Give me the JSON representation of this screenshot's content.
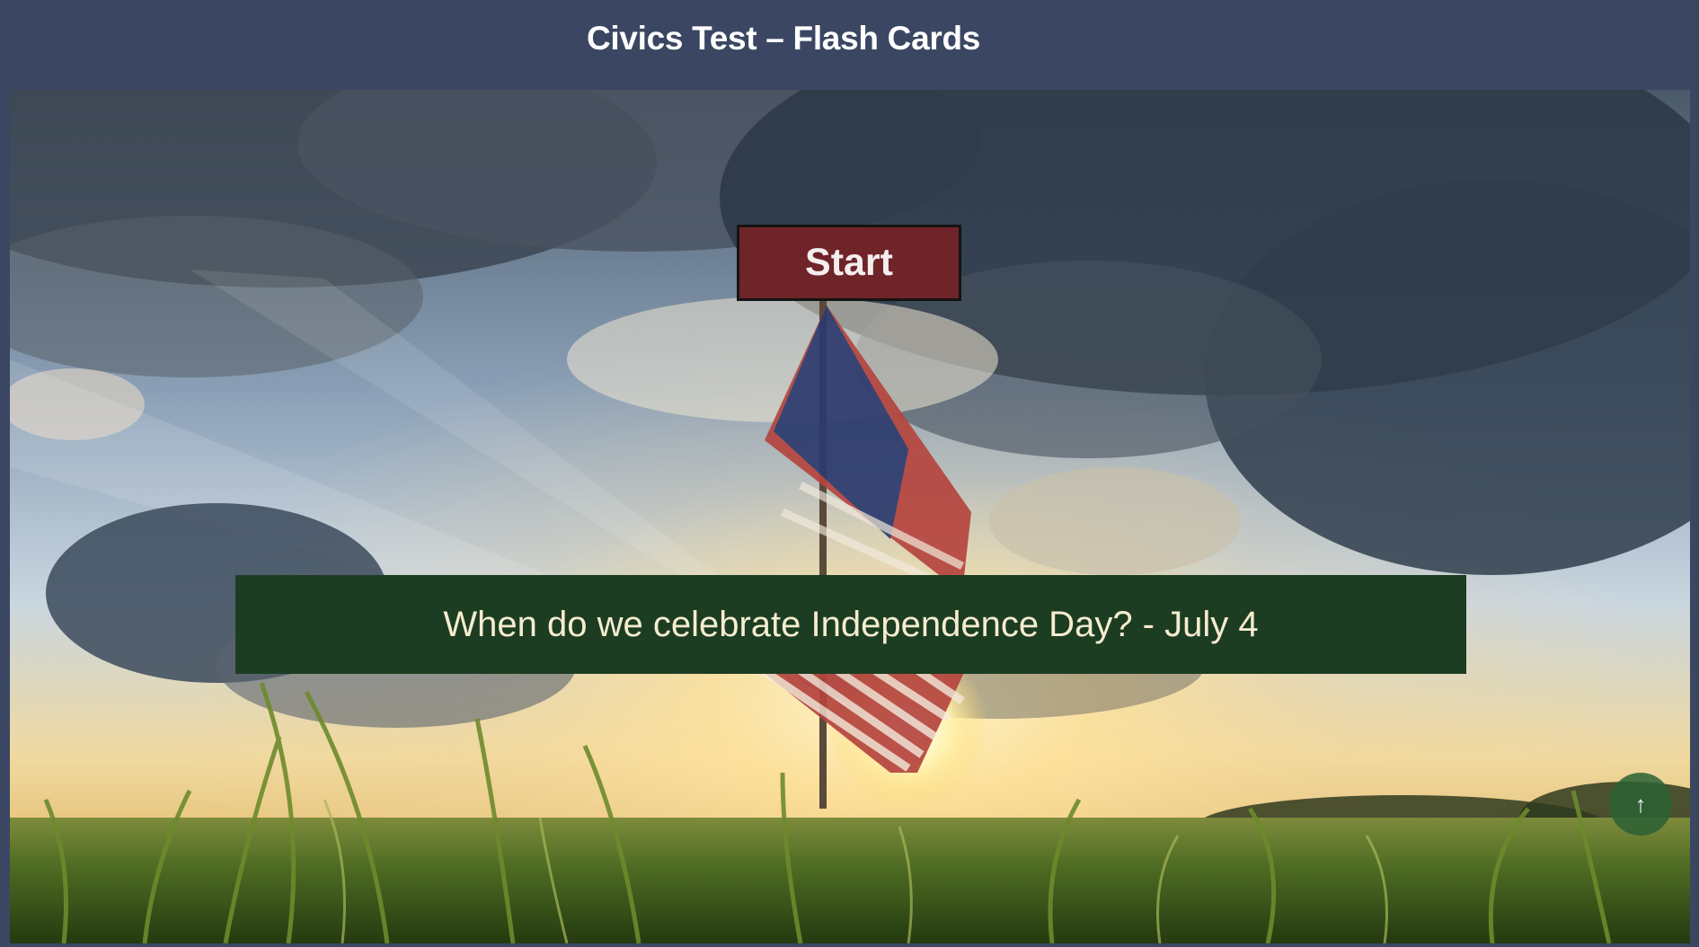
{
  "header": {
    "title": "Civics Test – Flash Cards"
  },
  "controls": {
    "start_label": "Start",
    "scroll_top_icon": "arrow-up-icon",
    "scroll_top_glyph": "↑"
  },
  "flash_card": {
    "text": "When do we celebrate Independence Day? - July 4"
  },
  "colors": {
    "header_bg": "#3b4762",
    "start_button_bg": "#6f2429",
    "card_bg": "#1c3d22",
    "card_text": "#f6ecd0",
    "scroll_top_bg": "#2c6034"
  }
}
